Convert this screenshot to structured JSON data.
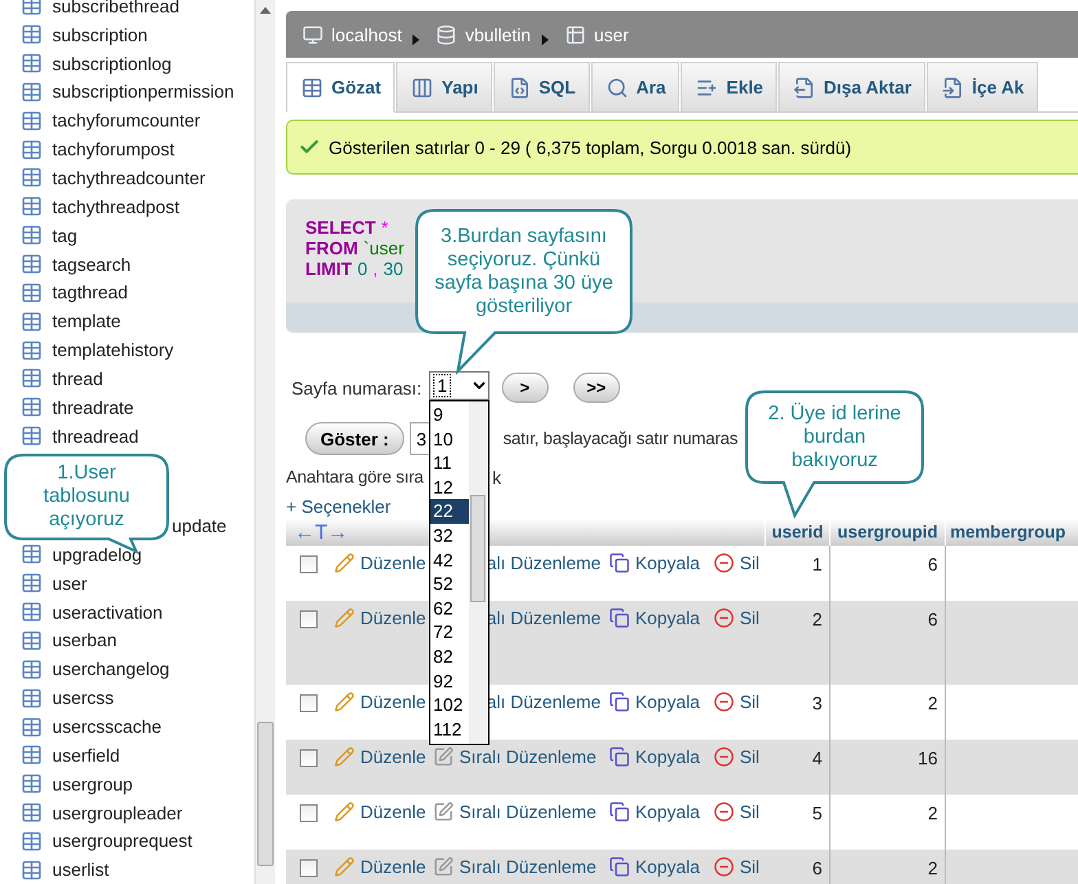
{
  "sidebar": {
    "items": [
      {
        "label": "subscribethread",
        "kind": "table"
      },
      {
        "label": "subscription",
        "kind": "table"
      },
      {
        "label": "subscriptionlog",
        "kind": "table"
      },
      {
        "label": "subscriptionpermission",
        "kind": "table"
      },
      {
        "label": "tachyforumcounter",
        "kind": "table"
      },
      {
        "label": "tachyforumpost",
        "kind": "table"
      },
      {
        "label": "tachythreadcounter",
        "kind": "table"
      },
      {
        "label": "tachythreadpost",
        "kind": "table"
      },
      {
        "label": "tag",
        "kind": "table"
      },
      {
        "label": "tagsearch",
        "kind": "table"
      },
      {
        "label": "tagthread",
        "kind": "table"
      },
      {
        "label": "template",
        "kind": "table"
      },
      {
        "label": "templatehistory",
        "kind": "table"
      },
      {
        "label": "thread",
        "kind": "table"
      },
      {
        "label": "threadrate",
        "kind": "table"
      },
      {
        "label": "threadread",
        "kind": "table"
      },
      {
        "label": "update",
        "kind": "partial"
      },
      {
        "label": "upgradelog",
        "kind": "table"
      },
      {
        "label": "user",
        "kind": "table"
      },
      {
        "label": "useractivation",
        "kind": "table"
      },
      {
        "label": "userban",
        "kind": "table"
      },
      {
        "label": "userchangelog",
        "kind": "table"
      },
      {
        "label": "usercss",
        "kind": "table"
      },
      {
        "label": "usercsscache",
        "kind": "table"
      },
      {
        "label": "userfield",
        "kind": "table"
      },
      {
        "label": "usergroup",
        "kind": "table"
      },
      {
        "label": "usergroupleader",
        "kind": "table"
      },
      {
        "label": "usergrouprequest",
        "kind": "table"
      },
      {
        "label": "userlist",
        "kind": "table"
      }
    ]
  },
  "breadcrumb": [
    {
      "label": "localhost",
      "kind": "server"
    },
    {
      "label": "vbulletin",
      "kind": "database"
    },
    {
      "label": "user",
      "kind": "table"
    }
  ],
  "tabs": [
    {
      "label": "Gözat",
      "kind": "browse",
      "selected": true
    },
    {
      "label": "Yapı",
      "kind": "structure",
      "selected": false
    },
    {
      "label": "SQL",
      "kind": "sql",
      "selected": false
    },
    {
      "label": "Ara",
      "kind": "search",
      "selected": false
    },
    {
      "label": "Ekle",
      "kind": "insert",
      "selected": false
    },
    {
      "label": "Dışa Aktar",
      "kind": "export",
      "selected": false
    },
    {
      "label": "İçe Ak",
      "kind": "import",
      "selected": false
    }
  ],
  "notice": {
    "text": "Gösterilen satırlar 0 - 29 ( 6,375 toplam, Sorgu 0.0018 san. sürdü)"
  },
  "sql": {
    "lines": [
      [
        {
          "text": "SELECT",
          "kind": "keyword"
        },
        {
          "text": "*",
          "kind": "operator"
        }
      ],
      [
        {
          "text": "FROM",
          "kind": "keyword"
        },
        {
          "text": "`user",
          "kind": "name"
        }
      ],
      [
        {
          "text": "LIMIT",
          "kind": "keyword"
        },
        {
          "text": "0",
          "kind": "number"
        },
        {
          "text": ",",
          "kind": "operator"
        },
        {
          "text": "30",
          "kind": "number"
        }
      ]
    ]
  },
  "pagination": {
    "label": "Sayfa numarası:",
    "value": "1",
    "buttons": [
      ">",
      ">>"
    ],
    "options": [
      {
        "label": "9",
        "selected": false
      },
      {
        "label": "10",
        "selected": false
      },
      {
        "label": "11",
        "selected": false
      },
      {
        "label": "12",
        "selected": false
      },
      {
        "label": "22",
        "selected": true
      },
      {
        "label": "32",
        "selected": false
      },
      {
        "label": "42",
        "selected": false
      },
      {
        "label": "52",
        "selected": false
      },
      {
        "label": "62",
        "selected": false
      },
      {
        "label": "72",
        "selected": false
      },
      {
        "label": "82",
        "selected": false
      },
      {
        "label": "92",
        "selected": false
      },
      {
        "label": "102",
        "selected": false
      },
      {
        "label": "112",
        "selected": false
      }
    ]
  },
  "show_row": {
    "button": "Göster :",
    "value": "3",
    "text": "satır, başlayacağı satır numaras"
  },
  "sort_row": {
    "label": "Anahtara göre sıra",
    "tail": "k"
  },
  "options_link": "+ Seçenekler",
  "table": {
    "columns": [
      "←T→",
      "userid",
      "usergroupid",
      "membergroup"
    ],
    "rows": [
      {
        "kind": "partial",
        "checked": false,
        "edit": "Düzenle",
        "inline_edit": "alı Düzenleme",
        "copy": "Kopyala",
        "delete": "Sil",
        "userid": "1",
        "usergroupid": "6"
      },
      {
        "kind": "partial",
        "checked": false,
        "edit": "Düzenle",
        "inline_edit": "alı Düzenleme",
        "copy": "Kopyala",
        "delete": "Sil",
        "userid": "2",
        "usergroupid": "6"
      },
      {
        "kind": "partial",
        "checked": false,
        "edit": "Düzenle",
        "inline_edit": "alı Düzenleme",
        "copy": "Kopyala",
        "delete": "Sil",
        "userid": "3",
        "usergroupid": "2"
      },
      {
        "kind": "full",
        "checked": false,
        "edit": "Düzenle",
        "inline_edit": "Sıralı Düzenleme",
        "copy": "Kopyala",
        "delete": "Sil",
        "userid": "4",
        "usergroupid": "16"
      },
      {
        "kind": "full",
        "checked": false,
        "edit": "Düzenle",
        "inline_edit": "Sıralı Düzenleme",
        "copy": "Kopyala",
        "delete": "Sil",
        "userid": "5",
        "usergroupid": "2"
      },
      {
        "kind": "full",
        "checked": false,
        "edit": "Düzenle",
        "inline_edit": "Sıralı Düzenleme",
        "copy": "Kopyala",
        "delete": "Sil",
        "userid": "6",
        "usergroupid": "2"
      }
    ]
  },
  "callouts": [
    {
      "text": "1.User tablosunu açıyoruz"
    },
    {
      "text": "3.Burdan sayfasını seçiyoruz. Çünkü sayfa başına 30 üye gösteriliyor"
    },
    {
      "text": "2. Üye id lerine burdan bakıyoruz"
    }
  ]
}
